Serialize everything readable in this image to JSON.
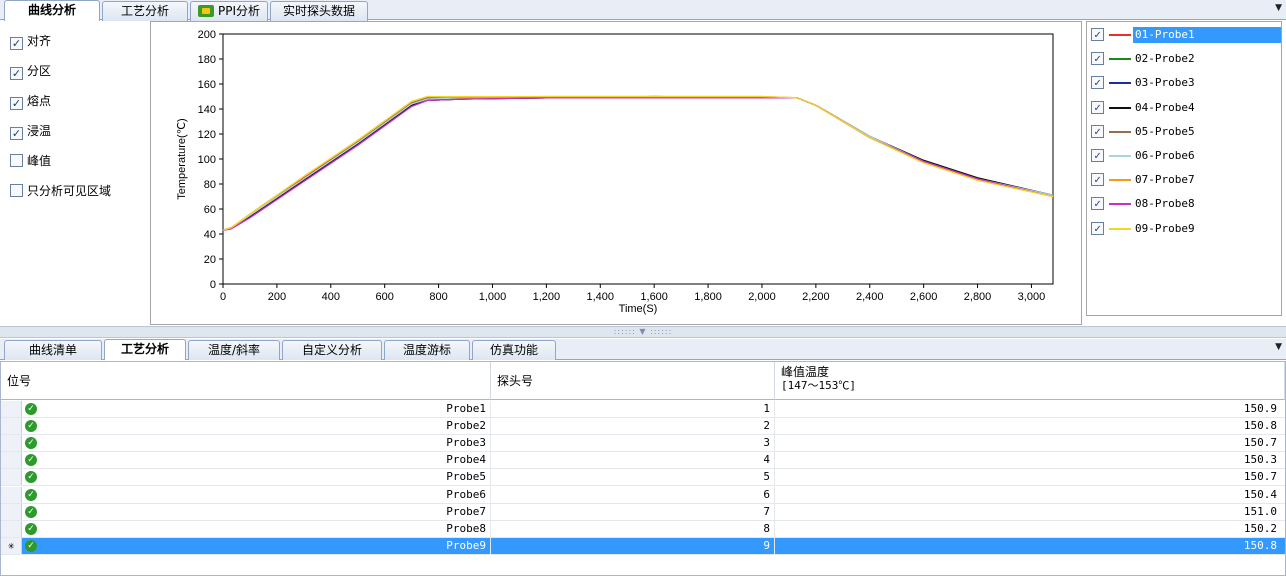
{
  "top_tabs": [
    {
      "label": "曲线分析",
      "active": true
    },
    {
      "label": "工艺分析",
      "active": false
    },
    {
      "label": "PPI分析",
      "active": false,
      "icon": "ppi-icon"
    },
    {
      "label": "实时探头数据",
      "active": false
    }
  ],
  "options": [
    {
      "label": "对齐",
      "checked": true
    },
    {
      "label": "分区",
      "checked": true
    },
    {
      "label": "熔点",
      "checked": true
    },
    {
      "label": "浸温",
      "checked": true
    },
    {
      "label": "峰值",
      "checked": false
    },
    {
      "label": "只分析可见区域",
      "checked": false
    }
  ],
  "check_mark": "✓",
  "chart_data": {
    "type": "line",
    "xlabel": "Time(S)",
    "ylabel": "Temperature(℃)",
    "xlim": [
      0,
      3080
    ],
    "ylim": [
      0,
      200
    ],
    "x_ticks": [
      0,
      200,
      400,
      600,
      800,
      1000,
      1200,
      1400,
      1600,
      1800,
      2000,
      2200,
      2400,
      2600,
      2800,
      3000
    ],
    "x_tick_labels": [
      "0",
      "200",
      "400",
      "600",
      "800",
      "1,000",
      "1,200",
      "1,400",
      "1,600",
      "1,800",
      "2,000",
      "2,200",
      "2,400",
      "2,600",
      "2,800",
      "3,000"
    ],
    "y_ticks": [
      0,
      20,
      40,
      60,
      80,
      100,
      120,
      140,
      160,
      180,
      200
    ],
    "grid": false,
    "series": [
      {
        "name": "01-Probe1",
        "color": "#e8302a",
        "x": [
          0,
          30,
          100,
          300,
          500,
          700,
          760,
          900,
          1200,
          1600,
          2000,
          2130,
          2200,
          2400,
          2600,
          2800,
          3080
        ],
        "y": [
          43,
          45,
          55,
          85,
          114,
          145,
          149,
          148,
          149,
          149,
          149,
          149,
          143,
          118,
          98,
          84,
          71
        ]
      },
      {
        "name": "02-Probe2",
        "color": "#1a8a1a",
        "x": [
          0,
          30,
          100,
          300,
          500,
          700,
          760,
          900,
          1200,
          1600,
          2000,
          2130,
          2200,
          2400,
          2600,
          2800,
          3080
        ],
        "y": [
          43,
          45,
          55,
          84,
          113,
          144,
          148,
          149,
          149,
          150,
          149,
          149,
          143,
          118,
          98,
          84,
          71
        ]
      },
      {
        "name": "03-Probe3",
        "color": "#1c2fa0",
        "x": [
          0,
          30,
          100,
          300,
          500,
          700,
          760,
          900,
          1200,
          1600,
          2000,
          2130,
          2200,
          2400,
          2600,
          2800,
          3080
        ],
        "y": [
          43,
          45,
          54,
          83,
          112,
          143,
          147,
          148,
          149,
          149,
          149,
          149,
          143,
          118,
          98,
          84,
          71
        ]
      },
      {
        "name": "04-Probe4",
        "color": "#111111",
        "x": [
          0,
          30,
          100,
          300,
          500,
          700,
          760,
          900,
          1200,
          1600,
          2000,
          2130,
          2200,
          2400,
          2600,
          2800,
          3080
        ],
        "y": [
          43,
          45,
          54,
          83,
          112,
          143,
          147,
          148,
          149,
          149,
          149,
          149,
          143,
          118,
          99,
          85,
          71
        ]
      },
      {
        "name": "05-Probe5",
        "color": "#9a6b4b",
        "x": [
          0,
          30,
          100,
          300,
          500,
          700,
          760,
          900,
          1200,
          1600,
          2000,
          2130,
          2200,
          2400,
          2600,
          2800,
          3080
        ],
        "y": [
          43,
          45,
          55,
          84,
          114,
          145,
          149,
          149,
          149,
          150,
          149,
          149,
          143,
          118,
          98,
          84,
          71
        ]
      },
      {
        "name": "06-Probe6",
        "color": "#a8d4e6",
        "x": [
          0,
          30,
          100,
          300,
          500,
          700,
          760,
          900,
          1200,
          1600,
          2000,
          2130,
          2200,
          2400,
          2600,
          2800,
          3080
        ],
        "y": [
          43,
          45,
          55,
          84,
          113,
          144,
          148,
          149,
          149,
          149,
          149,
          149,
          143,
          118,
          98,
          84,
          71
        ]
      },
      {
        "name": "07-Probe7",
        "color": "#f39a1c",
        "x": [
          0,
          30,
          100,
          300,
          500,
          700,
          760,
          900,
          1200,
          1600,
          2000,
          2130,
          2200,
          2400,
          2600,
          2800,
          3080
        ],
        "y": [
          43,
          45,
          56,
          86,
          115,
          146,
          150,
          149,
          150,
          150,
          150,
          149,
          143,
          117,
          97,
          83,
          70
        ]
      },
      {
        "name": "08-Probe8",
        "color": "#cc2fc6",
        "x": [
          0,
          30,
          100,
          300,
          500,
          700,
          760,
          900,
          1200,
          1600,
          2000,
          2130,
          2200,
          2400,
          2600,
          2800,
          3080
        ],
        "y": [
          43,
          44,
          53,
          82,
          111,
          142,
          147,
          148,
          149,
          149,
          149,
          149,
          143,
          117,
          98,
          84,
          70
        ]
      },
      {
        "name": "09-Probe9",
        "color": "#f1d623",
        "x": [
          0,
          30,
          100,
          300,
          500,
          700,
          760,
          900,
          1200,
          1600,
          2000,
          2130,
          2200,
          2400,
          2600,
          2800,
          3080
        ],
        "y": [
          43,
          45,
          56,
          86,
          115,
          146,
          150,
          150,
          150,
          150,
          150,
          149,
          143,
          117,
          97,
          83,
          70
        ]
      }
    ]
  },
  "legend": {
    "selected_index": 0,
    "items": [
      {
        "label": "01-Probe1",
        "color": "#e8302a",
        "checked": true
      },
      {
        "label": "02-Probe2",
        "color": "#1a8a1a",
        "checked": true
      },
      {
        "label": "03-Probe3",
        "color": "#1c2fa0",
        "checked": true
      },
      {
        "label": "04-Probe4",
        "color": "#111111",
        "checked": true
      },
      {
        "label": "05-Probe5",
        "color": "#9a6b4b",
        "checked": true
      },
      {
        "label": "06-Probe6",
        "color": "#a8d4e6",
        "checked": true
      },
      {
        "label": "07-Probe7",
        "color": "#f39a1c",
        "checked": true
      },
      {
        "label": "08-Probe8",
        "color": "#cc2fc6",
        "checked": true
      },
      {
        "label": "09-Probe9",
        "color": "#f1d623",
        "checked": true
      }
    ]
  },
  "bottom_tabs": [
    {
      "label": "曲线清单",
      "active": false
    },
    {
      "label": "工艺分析",
      "active": true
    },
    {
      "label": "温度/斜率",
      "active": false
    },
    {
      "label": "自定义分析",
      "active": false
    },
    {
      "label": "温度游标",
      "active": false
    },
    {
      "label": "仿真功能",
      "active": false
    }
  ],
  "table": {
    "columns": {
      "position": "位号",
      "probe_no": "探头号",
      "peak_temp": "峰值温度",
      "peak_range": "[147～153℃]"
    },
    "status_icon": "✓",
    "new_row_marker": "✳",
    "selected_index": 8,
    "rows": [
      {
        "position": "Probe1",
        "probe_no": "1",
        "peak_temp": "150.9"
      },
      {
        "position": "Probe2",
        "probe_no": "2",
        "peak_temp": "150.8"
      },
      {
        "position": "Probe3",
        "probe_no": "3",
        "peak_temp": "150.7"
      },
      {
        "position": "Probe4",
        "probe_no": "4",
        "peak_temp": "150.3"
      },
      {
        "position": "Probe5",
        "probe_no": "5",
        "peak_temp": "150.7"
      },
      {
        "position": "Probe6",
        "probe_no": "6",
        "peak_temp": "150.4"
      },
      {
        "position": "Probe7",
        "probe_no": "7",
        "peak_temp": "151.0"
      },
      {
        "position": "Probe8",
        "probe_no": "8",
        "peak_temp": "150.2"
      },
      {
        "position": "Probe9",
        "probe_no": "9",
        "peak_temp": "150.8"
      }
    ]
  }
}
